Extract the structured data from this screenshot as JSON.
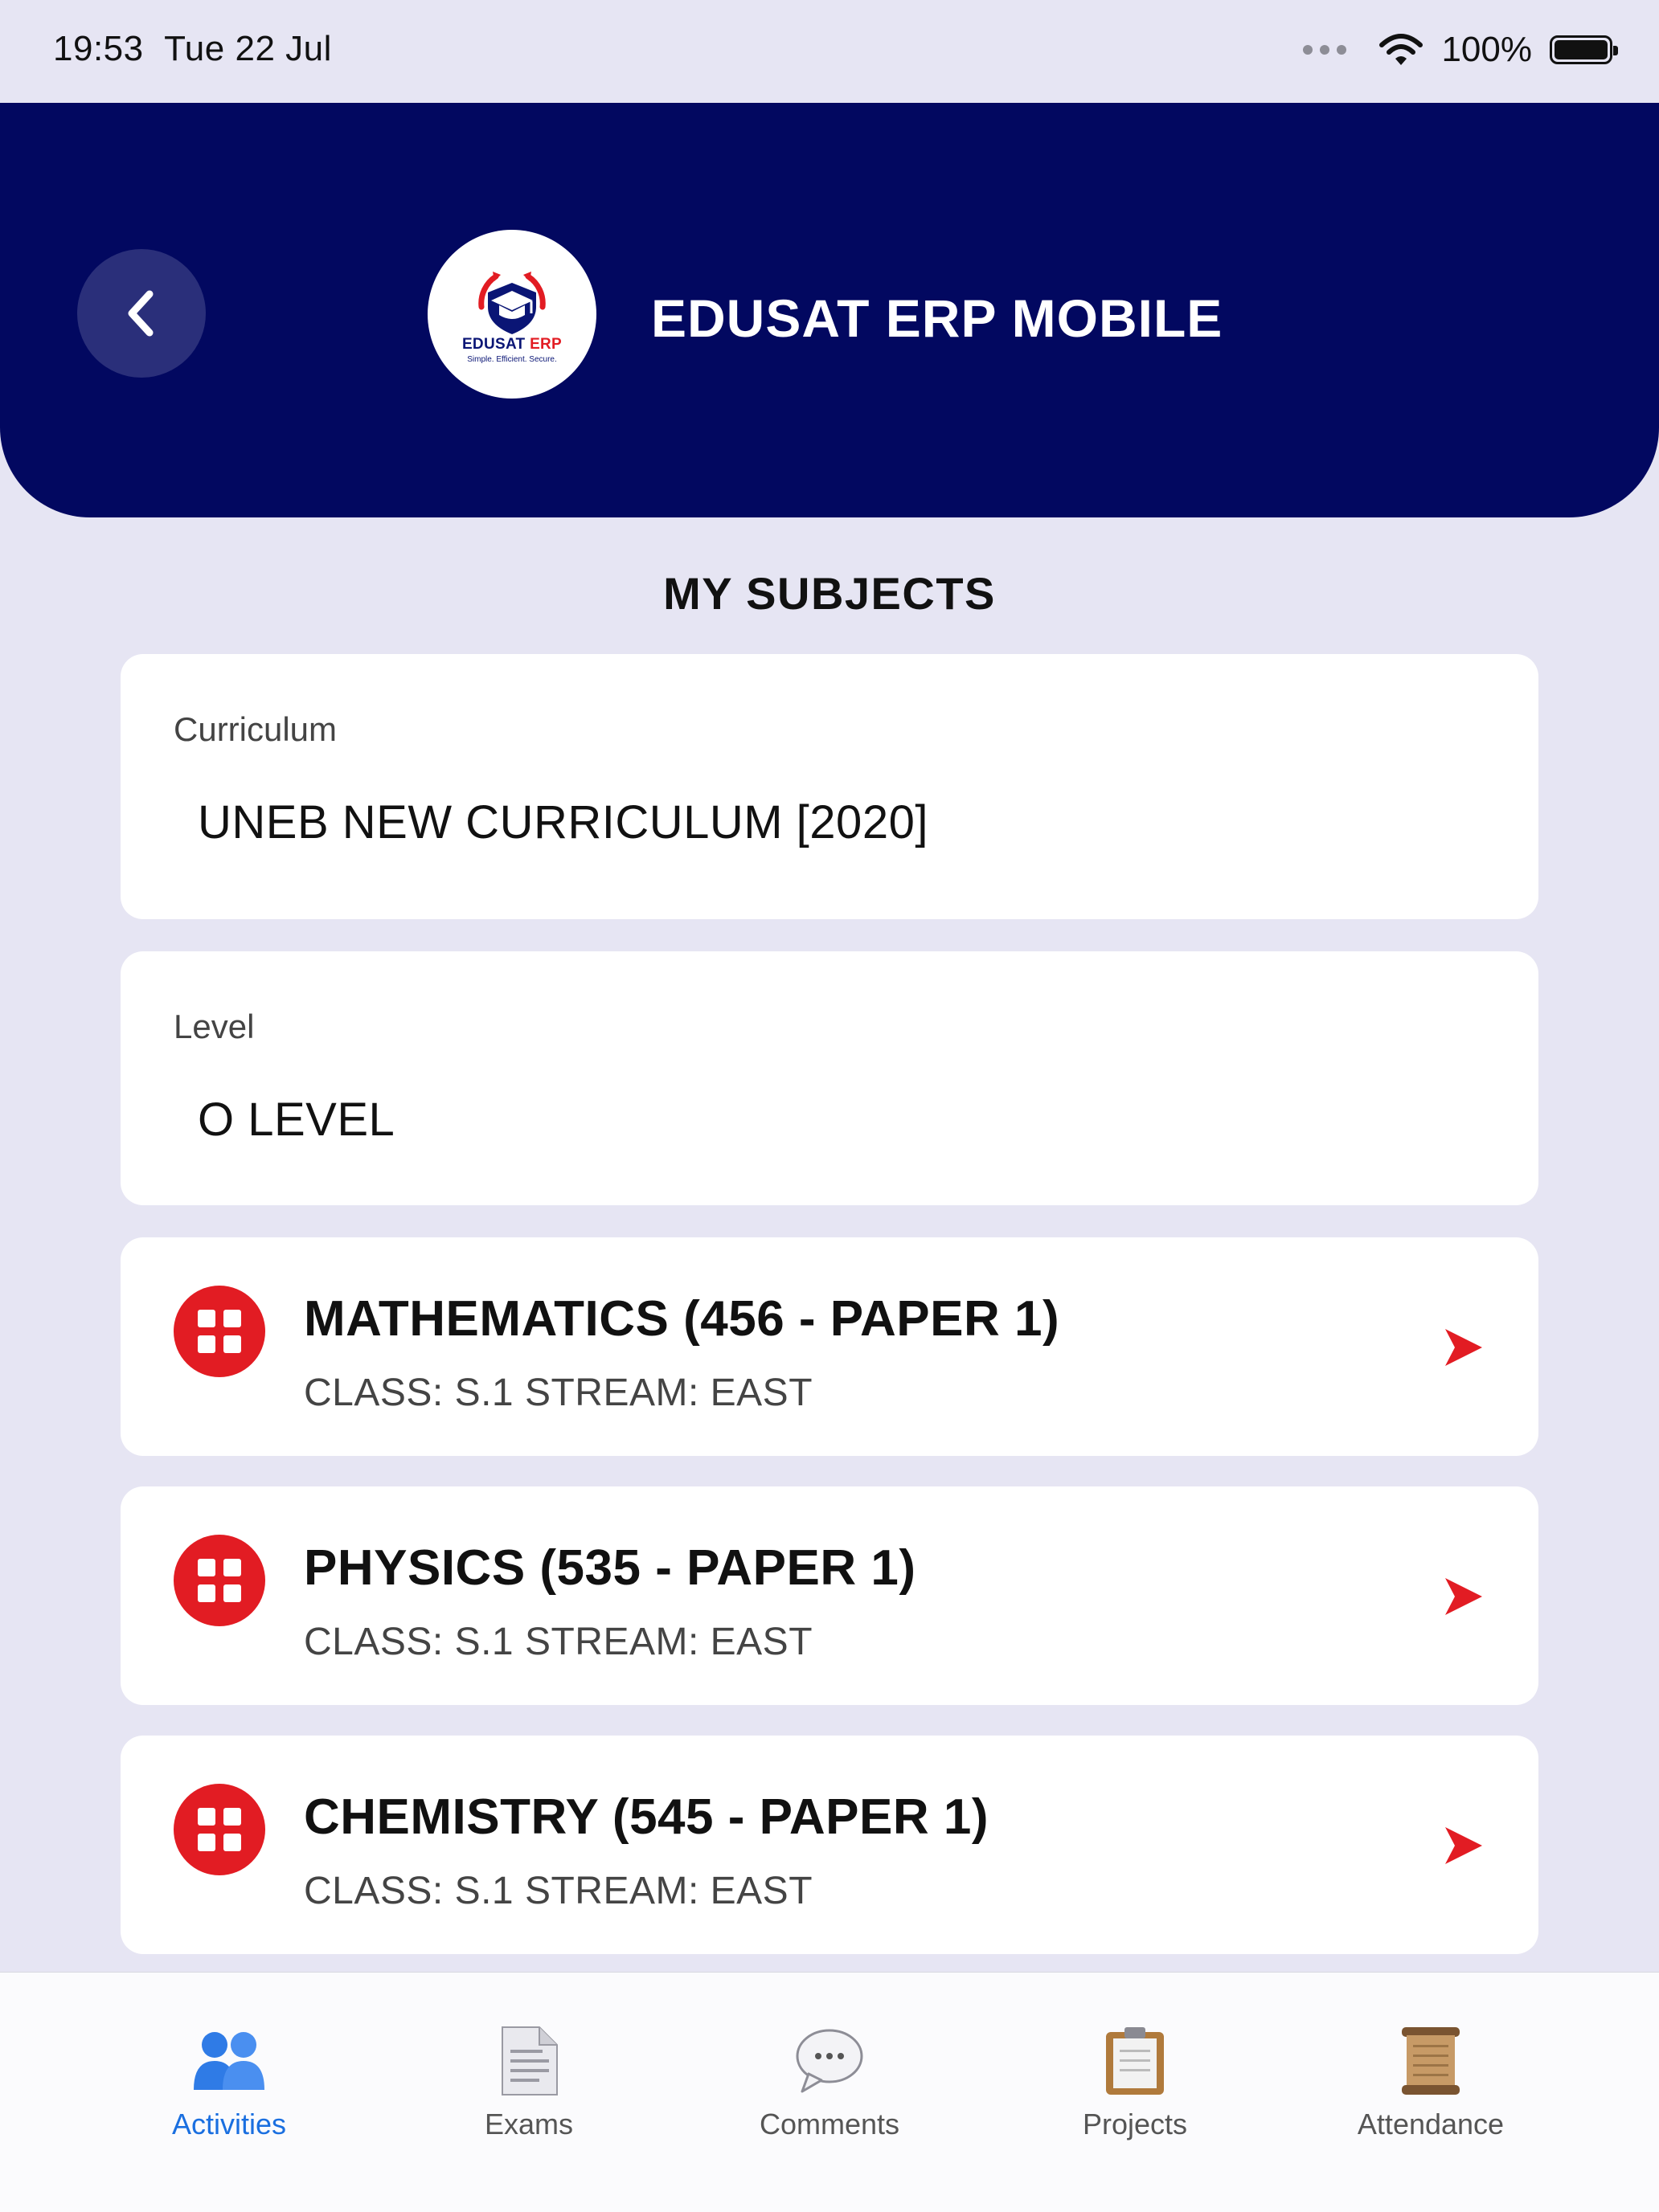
{
  "status_bar": {
    "time": "19:53",
    "date": "Tue 22 Jul",
    "battery": "100%"
  },
  "header": {
    "app_title": "EDUSAT ERP MOBILE",
    "logo_name_1": "EDUSAT",
    "logo_name_2": "ERP",
    "logo_tagline": "Simple. Efficient. Secure."
  },
  "page": {
    "title": "MY SUBJECTS"
  },
  "curriculum": {
    "label": "Curriculum",
    "value": "UNEB NEW CURRICULUM [2020]"
  },
  "level": {
    "label": "Level",
    "value": "O LEVEL"
  },
  "subjects": [
    {
      "title": "MATHEMATICS (456 - PAPER 1)",
      "meta": "CLASS: S.1 STREAM: EAST"
    },
    {
      "title": "PHYSICS (535 - PAPER 1)",
      "meta": "CLASS: S.1 STREAM: EAST"
    },
    {
      "title": "CHEMISTRY (545 - PAPER 1)",
      "meta": "CLASS: S.1 STREAM: EAST"
    }
  ],
  "tabs": [
    {
      "label": "Activities",
      "icon": "people-icon",
      "active": true
    },
    {
      "label": "Exams",
      "icon": "document-icon",
      "active": false
    },
    {
      "label": "Comments",
      "icon": "speech-bubble-icon",
      "active": false
    },
    {
      "label": "Projects",
      "icon": "clipboard-icon",
      "active": false
    },
    {
      "label": "Attendance",
      "icon": "scroll-icon",
      "active": false
    }
  ],
  "colors": {
    "header_bg": "#020860",
    "accent_red": "#e21c23",
    "active_tab": "#1a6fe0",
    "page_bg": "#e6e5f3"
  }
}
